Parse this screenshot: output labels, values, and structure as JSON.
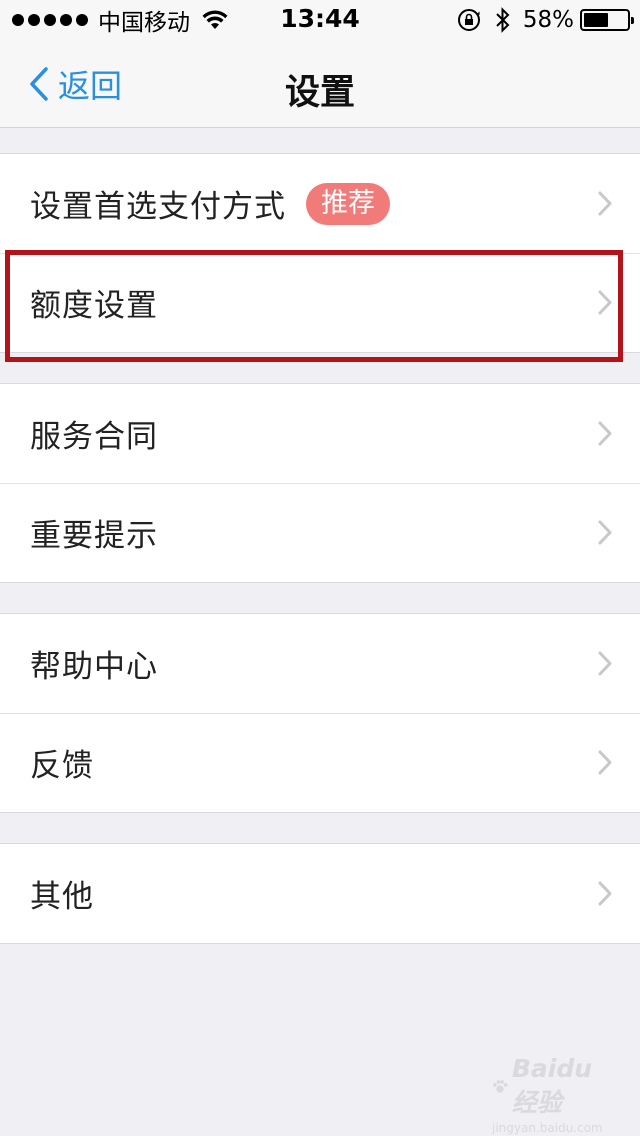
{
  "status_bar": {
    "carrier": "中国移动",
    "time": "13:44",
    "battery_percent": "58%",
    "battery_level": 0.58
  },
  "nav": {
    "back_label": "返回",
    "title": "设置"
  },
  "groups": [
    {
      "items": [
        {
          "label": "设置首选支付方式",
          "badge": "推荐"
        },
        {
          "label": "额度设置"
        }
      ]
    },
    {
      "items": [
        {
          "label": "服务合同"
        },
        {
          "label": "重要提示"
        }
      ]
    },
    {
      "items": [
        {
          "label": "帮助中心"
        },
        {
          "label": "反馈"
        }
      ]
    },
    {
      "items": [
        {
          "label": "其他"
        }
      ]
    }
  ],
  "watermark": {
    "brand": "Baidu 经验",
    "site": "jingyan.baidu.com"
  },
  "colors": {
    "accent": "#2a8fe0",
    "badge": "#f07b78",
    "highlight": "#b5131a",
    "background": "#efeff4"
  }
}
